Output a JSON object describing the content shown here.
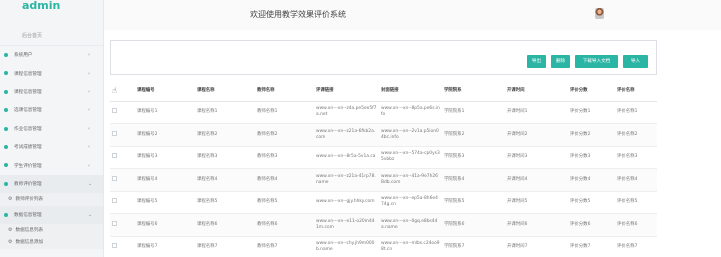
{
  "brand": {
    "name": "admin"
  },
  "sidebar": {
    "home": "后台首页",
    "items": [
      {
        "label": "系统用户",
        "arrow": "‹"
      },
      {
        "label": "课程信息管理",
        "arrow": "‹"
      },
      {
        "label": "课程信息管理",
        "arrow": "‹"
      },
      {
        "label": "选课信息管理",
        "arrow": "‹"
      },
      {
        "label": "作业信息管理",
        "arrow": "‹"
      },
      {
        "label": "考试成绩管理",
        "arrow": "‹"
      },
      {
        "label": "学生评价管理",
        "arrow": "‹"
      },
      {
        "label": "教师评价管理",
        "arrow": "⌄"
      },
      {
        "label": "教师评价列表"
      },
      {
        "label": "数据信息管理",
        "arrow": "⌄"
      },
      {
        "label": "数据信息列表"
      },
      {
        "label": "数据信息添加"
      }
    ]
  },
  "header": {
    "title": "欢迎使用教学效果评价系统"
  },
  "toolbar": {
    "export": "导出",
    "delete": "删除",
    "download": "下载导入文档",
    "import": "导入"
  },
  "table": {
    "columns": [
      "课程编号",
      "课程名称",
      "教师名称",
      "评课链接",
      "封面链接",
      "学院院系",
      "开课时间",
      "评价分数",
      "评价名称"
    ],
    "rows": [
      [
        "课程编号1",
        "课程名称1",
        "教师名称1",
        "www.xn---xn--z4a.pe5ee5f7a.net",
        "www.xn---xn--8p5a.pe6s.info",
        "学院院系1",
        "开课时间1",
        "评价分数1",
        "评价名称1"
      ],
      [
        "课程编号2",
        "课程名称2",
        "教师名称2",
        "www.xn---xn--z21a-6fkb2a.com",
        "www.xn---xn--2v1a.p5ion04bc.info",
        "学院院系2",
        "开课时间2",
        "评价分数2",
        "评价名称2"
      ],
      [
        "课程编号3",
        "课程名称3",
        "教师名称3",
        "www.xn---xn--8r5a-5v1a.ca",
        "www.xn---xn--574a-cp0ys35vbbz",
        "学院院系3",
        "开课时间3",
        "评价分数3",
        "评价名称3"
      ],
      [
        "课程编号4",
        "课程名称4",
        "教师名称4",
        "www.xn---xn--z21a-41rp78.name",
        "www.xn---xn--41a-9e7h26Bdb.com",
        "学院院系4",
        "开课时间4",
        "评价分数4",
        "评价名称4"
      ],
      [
        "课程编号5",
        "课程名称5",
        "教师名称5",
        "www.xn---xn--gjy.hhky.com",
        "www.xn---xn--ep5a-8h6e474g.cn",
        "学院院系5",
        "开课时间5",
        "评价分数5",
        "评价名称5"
      ],
      [
        "课程编号6",
        "课程名称6",
        "教师名称6",
        "www.xn---xn--e11-o20m441m.com",
        "www.xn---xn--0gq.e8bs44a.name",
        "学院院系6",
        "开课时间6",
        "评价分数6",
        "评价名称6"
      ],
      [
        "课程编号7",
        "课程名称7",
        "教师名称7",
        "www.xn---xn--chy.jh9m000b.name",
        "www.xn---xn--mlbs.c24oo98t.cn",
        "学院院系7",
        "开课时间7",
        "评价分数7",
        "评价名称7"
      ]
    ]
  }
}
